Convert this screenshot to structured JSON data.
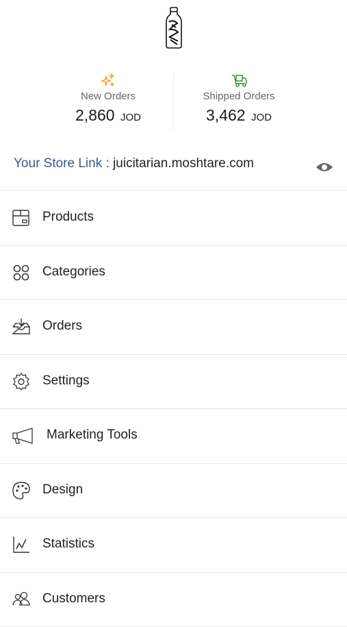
{
  "stats": {
    "new_orders": {
      "label": "New Orders",
      "value": "2,860",
      "currency": "JOD",
      "icon": "sparkles-icon",
      "color": "#f5a524"
    },
    "shipped_orders": {
      "label": "Shipped Orders",
      "value": "3,462",
      "currency": "JOD",
      "icon": "delivery-truck-icon",
      "color": "#2f8f3c"
    }
  },
  "store_link": {
    "label": "Your Store Link :",
    "url": "juicitarian.moshtare.com",
    "icon": "eye-icon"
  },
  "menu": {
    "items": [
      {
        "label": "Products",
        "icon": "box-icon"
      },
      {
        "label": "Categories",
        "icon": "grid-circles-icon"
      },
      {
        "label": "Orders",
        "icon": "inbox-download-icon"
      },
      {
        "label": "Settings",
        "icon": "gear-icon"
      },
      {
        "label": "Marketing Tools",
        "icon": "megaphone-icon"
      },
      {
        "label": "Design",
        "icon": "palette-icon"
      },
      {
        "label": "Statistics",
        "icon": "line-chart-icon"
      },
      {
        "label": "Customers",
        "icon": "users-icon"
      }
    ]
  },
  "colors": {
    "accent_link": "#3c5a8a",
    "divider": "#e8e8e8"
  }
}
